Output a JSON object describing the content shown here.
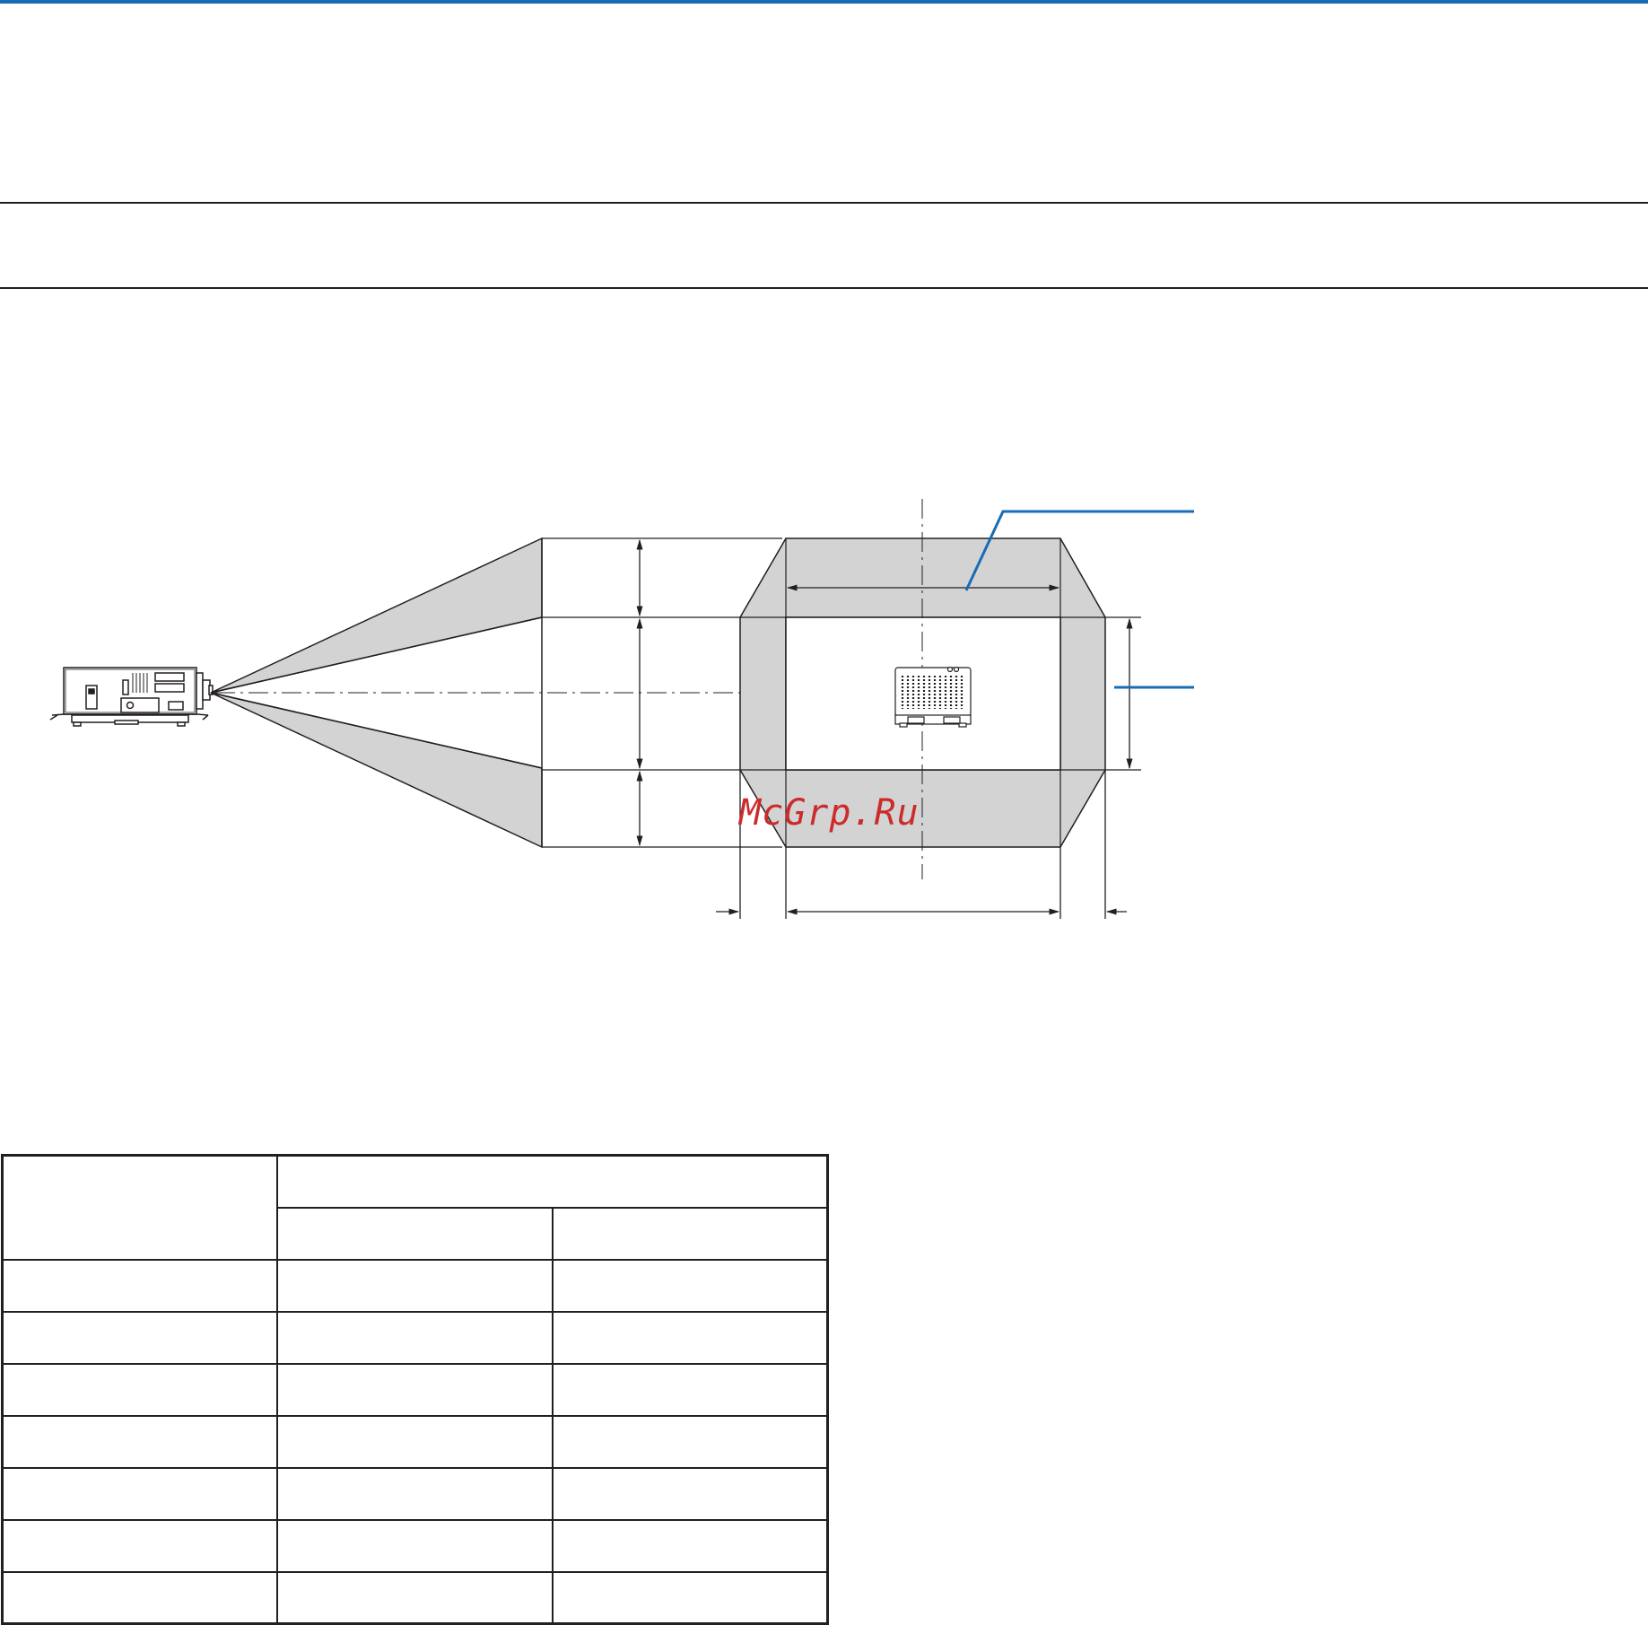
{
  "colors": {
    "accent_blue": "#1a6bb5",
    "line": "#231f20",
    "range_fill": "#d3d3d3",
    "watermark": "#cc2b2b"
  },
  "watermark": {
    "text": "McGrp.Ru"
  },
  "diagram": {
    "projector_side_icon": "projector-side-view-icon",
    "projector_front_icon": "projector-front-view-icon"
  },
  "table": {
    "header_top": [
      "",
      ""
    ],
    "header_sub": [
      "",
      ""
    ],
    "rows": [
      [
        "",
        "",
        ""
      ],
      [
        "",
        "",
        ""
      ],
      [
        "",
        "",
        ""
      ],
      [
        "",
        "",
        ""
      ],
      [
        "",
        "",
        ""
      ],
      [
        "",
        "",
        ""
      ],
      [
        "",
        "",
        ""
      ]
    ]
  }
}
